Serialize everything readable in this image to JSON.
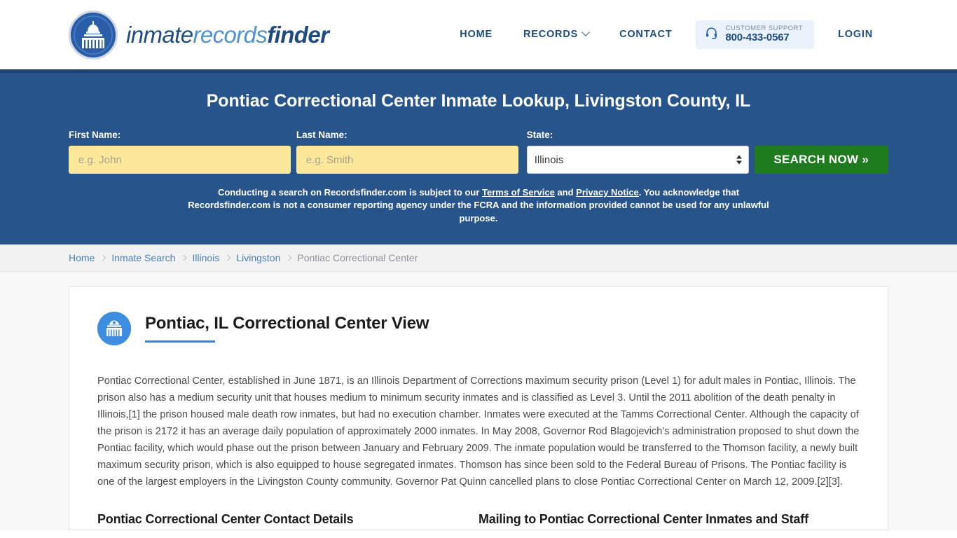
{
  "header": {
    "logo": {
      "part1": "inmate",
      "part2": "records",
      "part3": "finder",
      "seal_icon": "capitol-dome-seal"
    },
    "nav": [
      {
        "label": "HOME",
        "name": "nav-home"
      },
      {
        "label": "RECORDS",
        "name": "nav-records",
        "has_chevron": true
      },
      {
        "label": "CONTACT",
        "name": "nav-contact"
      },
      {
        "label": "LOGIN",
        "name": "nav-login"
      }
    ],
    "support": {
      "icon": "headset-icon",
      "label": "CUSTOMER SUPPORT",
      "phone": "800-433-0567"
    }
  },
  "hero": {
    "title": "Pontiac Correctional Center Inmate Lookup, Livingston County, IL",
    "first_name_label": "First Name:",
    "first_name_placeholder": "e.g. John",
    "first_name_value": "",
    "last_name_label": "Last Name:",
    "last_name_placeholder": "e.g. Smith",
    "last_name_value": "",
    "state_label": "State:",
    "state_value": "Illinois",
    "state_options": [
      "Illinois"
    ],
    "search_button": "SEARCH NOW »",
    "disclaimer_part1": "Conducting a search on Recordsfinder.com is subject to our ",
    "disclaimer_link1": "Terms of Service",
    "disclaimer_part2": " and ",
    "disclaimer_link2": "Privacy Notice",
    "disclaimer_part3": ". You acknowledge that Recordsfinder.com is not a consumer reporting agency under the FCRA and the information provided cannot be used for any unlawful purpose."
  },
  "breadcrumb": [
    {
      "label": "Home",
      "current": false
    },
    {
      "label": "Inmate Search",
      "current": false
    },
    {
      "label": "Illinois",
      "current": false
    },
    {
      "label": "Livingston",
      "current": false
    },
    {
      "label": "Pontiac Correctional Center",
      "current": true
    }
  ],
  "main": {
    "icon": "prison-building-icon",
    "title": "Pontiac, IL Correctional Center View",
    "body": "Pontiac Correctional Center, established in June 1871, is an Illinois Department of Corrections maximum security prison (Level 1) for adult males in Pontiac, Illinois. The prison also has a medium security unit that houses medium to minimum security inmates and is classified as Level 3. Until the 2011 abolition of the death penalty in Illinois,[1] the prison housed male death row inmates, but had no execution chamber. Inmates were executed at the Tamms Correctional Center. Although the capacity of the prison is 2172 it has an average daily population of approximately 2000 inmates. In May 2008, Governor Rod Blagojevich's administration proposed to shut down the Pontiac facility, which would phase out the prison between January and February 2009. The inmate population would be transferred to the Thomson facility, a newly built maximum security prison, which is also equipped to house segregated inmates. Thomson has since been sold to the Federal Bureau of Prisons. The Pontiac facility is one of the largest employers in the Livingston County community. Governor Pat Quinn cancelled plans to close Pontiac Correctional Center on March 12, 2009.[2][3].",
    "contact_heading": "Pontiac Correctional Center Contact Details",
    "mailing_heading": "Mailing to Pontiac Correctional Center Inmates and Staff"
  },
  "colors": {
    "hero_blue": "#28548c",
    "hero_border": "#1f4371",
    "brand_navy": "#1f4b7e",
    "brand_light_blue": "#4f91d4",
    "accent_blue": "#3d85c6",
    "search_green": "#1e7b1e",
    "input_yellow": "#fbe89a",
    "crumb_bg": "#f2f2f2"
  }
}
